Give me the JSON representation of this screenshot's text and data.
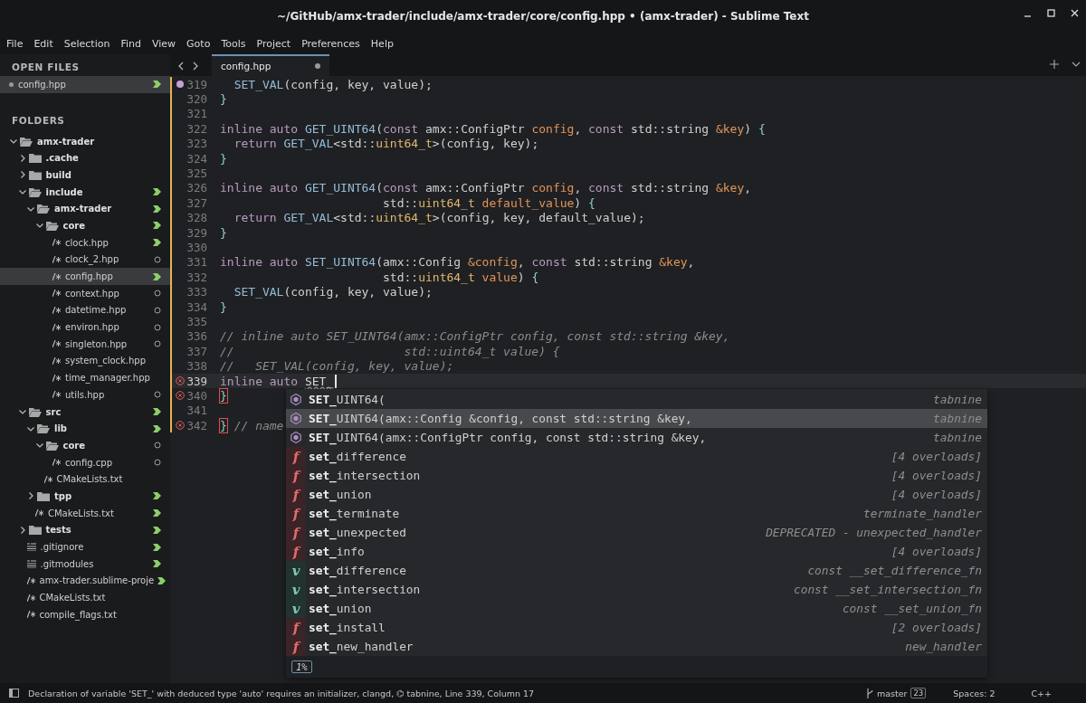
{
  "window": {
    "title": "~/GitHub/amx-trader/include/amx-trader/core/config.hpp • (amx-trader) - Sublime Text"
  },
  "menu": [
    "File",
    "Edit",
    "Selection",
    "Find",
    "View",
    "Goto",
    "Tools",
    "Project",
    "Preferences",
    "Help"
  ],
  "sidebar": {
    "open_files_header": "OPEN FILES",
    "open_files": [
      {
        "name": "config.hpp",
        "selected": true,
        "modified": true,
        "untracked": false
      }
    ],
    "folders_header": "FOLDERS",
    "tree": [
      {
        "name": "amx-trader",
        "kind": "folder",
        "expanded": true,
        "selected": false,
        "modified": false,
        "untracked": false,
        "children": [
          {
            "name": ".cache",
            "kind": "folder",
            "expanded": false,
            "selected": false,
            "modified": false,
            "untracked": false
          },
          {
            "name": "build",
            "kind": "folder",
            "expanded": false,
            "selected": false,
            "modified": false,
            "untracked": false
          },
          {
            "name": "include",
            "kind": "folder",
            "expanded": true,
            "selected": false,
            "modified": true,
            "untracked": false,
            "children": [
              {
                "name": "amx-trader",
                "kind": "folder",
                "expanded": true,
                "selected": false,
                "modified": true,
                "untracked": false,
                "children": [
                  {
                    "name": "core",
                    "kind": "folder",
                    "expanded": true,
                    "selected": false,
                    "modified": true,
                    "untracked": false,
                    "children": [
                      {
                        "name": "clock.hpp",
                        "kind": "code",
                        "selected": false,
                        "modified": true,
                        "untracked": false
                      },
                      {
                        "name": "clock_2.hpp",
                        "kind": "code",
                        "selected": false,
                        "modified": false,
                        "untracked": true
                      },
                      {
                        "name": "config.hpp",
                        "kind": "code",
                        "selected": true,
                        "modified": true,
                        "untracked": false
                      },
                      {
                        "name": "context.hpp",
                        "kind": "code",
                        "selected": false,
                        "modified": false,
                        "untracked": true
                      },
                      {
                        "name": "datetime.hpp",
                        "kind": "code",
                        "selected": false,
                        "modified": false,
                        "untracked": true
                      },
                      {
                        "name": "environ.hpp",
                        "kind": "code",
                        "selected": false,
                        "modified": false,
                        "untracked": true
                      },
                      {
                        "name": "singleton.hpp",
                        "kind": "code",
                        "selected": false,
                        "modified": false,
                        "untracked": true
                      },
                      {
                        "name": "system_clock.hpp",
                        "kind": "code",
                        "selected": false,
                        "modified": false,
                        "untracked": false
                      },
                      {
                        "name": "time_manager.hpp",
                        "kind": "code",
                        "selected": false,
                        "modified": false,
                        "untracked": false
                      },
                      {
                        "name": "utils.hpp",
                        "kind": "code",
                        "selected": false,
                        "modified": false,
                        "untracked": true
                      }
                    ]
                  }
                ]
              }
            ]
          },
          {
            "name": "src",
            "kind": "folder",
            "expanded": true,
            "selected": false,
            "modified": true,
            "untracked": false,
            "children": [
              {
                "name": "lib",
                "kind": "folder",
                "expanded": true,
                "selected": false,
                "modified": true,
                "untracked": false,
                "children": [
                  {
                    "name": "core",
                    "kind": "folder",
                    "expanded": true,
                    "selected": false,
                    "modified": false,
                    "untracked": true,
                    "children": [
                      {
                        "name": "config.cpp",
                        "kind": "code",
                        "selected": false,
                        "modified": false,
                        "untracked": true
                      }
                    ]
                  },
                  {
                    "name": "CMakeLists.txt",
                    "kind": "code",
                    "selected": false,
                    "modified": false,
                    "untracked": false
                  }
                ]
              },
              {
                "name": "tpp",
                "kind": "folder",
                "expanded": false,
                "selected": false,
                "modified": true,
                "untracked": false
              },
              {
                "name": "CMakeLists.txt",
                "kind": "code",
                "selected": false,
                "modified": true,
                "untracked": false
              }
            ]
          },
          {
            "name": "tests",
            "kind": "folder",
            "expanded": false,
            "selected": false,
            "modified": true,
            "untracked": false
          },
          {
            "name": ".gitignore",
            "kind": "text",
            "selected": false,
            "modified": true,
            "untracked": false
          },
          {
            "name": ".gitmodules",
            "kind": "text",
            "selected": false,
            "modified": true,
            "untracked": false
          },
          {
            "name": "amx-trader.sublime-proje",
            "kind": "code",
            "selected": false,
            "modified": true,
            "untracked": false
          },
          {
            "name": "CMakeLists.txt",
            "kind": "code",
            "selected": false,
            "modified": false,
            "untracked": false
          },
          {
            "name": "compile_flags.txt",
            "kind": "code",
            "selected": false,
            "modified": false,
            "untracked": false
          }
        ]
      }
    ]
  },
  "tabs": [
    {
      "label": "config.hpp",
      "selected": true,
      "dirty": true
    }
  ],
  "editor": {
    "lines": [
      {
        "number": "319",
        "bookmarked": true,
        "error": false,
        "current": false,
        "tokens": [
          {
            "text": "  SET_VAL",
            "kind": "function"
          },
          {
            "text": "(config, key, value);",
            "kind": "plain"
          }
        ]
      },
      {
        "number": "320",
        "bookmarked": false,
        "error": false,
        "current": false,
        "tokens": [
          {
            "text": "}",
            "kind": "brace"
          }
        ]
      },
      {
        "number": "321",
        "bookmarked": false,
        "error": false,
        "current": false
      },
      {
        "number": "322",
        "bookmarked": false,
        "error": false,
        "current": false,
        "tokens": [
          {
            "text": "inline auto ",
            "kind": "keyword"
          },
          {
            "text": "GET_UINT64",
            "kind": "function"
          },
          {
            "text": "(",
            "kind": "plain"
          },
          {
            "text": "const ",
            "kind": "keyword"
          },
          {
            "text": "amx::ConfigPtr ",
            "kind": "plain"
          },
          {
            "text": "config",
            "kind": "param"
          },
          {
            "text": ", ",
            "kind": "plain"
          },
          {
            "text": "const ",
            "kind": "keyword"
          },
          {
            "text": "std::string ",
            "kind": "plain"
          },
          {
            "text": "&key",
            "kind": "param"
          },
          {
            "text": ") ",
            "kind": "plain"
          },
          {
            "text": "{",
            "kind": "brace"
          }
        ]
      },
      {
        "number": "323",
        "bookmarked": false,
        "error": false,
        "current": false,
        "tokens": [
          {
            "text": "  return ",
            "kind": "keyword"
          },
          {
            "text": "GET_VAL",
            "kind": "function"
          },
          {
            "text": "<std::",
            "kind": "plain"
          },
          {
            "text": "uint64_t",
            "kind": "type"
          },
          {
            "text": ">(config, key);",
            "kind": "plain"
          }
        ]
      },
      {
        "number": "324",
        "bookmarked": false,
        "error": false,
        "current": false,
        "tokens": [
          {
            "text": "}",
            "kind": "brace"
          }
        ]
      },
      {
        "number": "325",
        "bookmarked": false,
        "error": false,
        "current": false
      },
      {
        "number": "326",
        "bookmarked": false,
        "error": false,
        "current": false,
        "tokens": [
          {
            "text": "inline auto ",
            "kind": "keyword"
          },
          {
            "text": "GET_UINT64",
            "kind": "function"
          },
          {
            "text": "(",
            "kind": "plain"
          },
          {
            "text": "const ",
            "kind": "keyword"
          },
          {
            "text": "amx::ConfigPtr ",
            "kind": "plain"
          },
          {
            "text": "config",
            "kind": "param"
          },
          {
            "text": ", ",
            "kind": "plain"
          },
          {
            "text": "const ",
            "kind": "keyword"
          },
          {
            "text": "std::string ",
            "kind": "plain"
          },
          {
            "text": "&key",
            "kind": "param"
          },
          {
            "text": ",",
            "kind": "plain"
          }
        ]
      },
      {
        "number": "327",
        "bookmarked": false,
        "error": false,
        "current": false,
        "tokens": [
          {
            "text": "                       std::",
            "kind": "plain"
          },
          {
            "text": "uint64_t ",
            "kind": "type"
          },
          {
            "text": "default_value",
            "kind": "param"
          },
          {
            "text": ") ",
            "kind": "plain"
          },
          {
            "text": "{",
            "kind": "brace"
          }
        ]
      },
      {
        "number": "328",
        "bookmarked": false,
        "error": false,
        "current": false,
        "tokens": [
          {
            "text": "  return ",
            "kind": "keyword"
          },
          {
            "text": "GET_VAL",
            "kind": "function"
          },
          {
            "text": "<std::",
            "kind": "plain"
          },
          {
            "text": "uint64_t",
            "kind": "type"
          },
          {
            "text": ">(config, key, default_value);",
            "kind": "plain"
          }
        ]
      },
      {
        "number": "329",
        "bookmarked": false,
        "error": false,
        "current": false,
        "tokens": [
          {
            "text": "}",
            "kind": "brace"
          }
        ]
      },
      {
        "number": "330",
        "bookmarked": false,
        "error": false,
        "current": false
      },
      {
        "number": "331",
        "bookmarked": false,
        "error": false,
        "current": false,
        "tokens": [
          {
            "text": "inline auto ",
            "kind": "keyword"
          },
          {
            "text": "SET_UINT64",
            "kind": "function"
          },
          {
            "text": "(amx::Config ",
            "kind": "plain"
          },
          {
            "text": "&config",
            "kind": "param"
          },
          {
            "text": ", ",
            "kind": "plain"
          },
          {
            "text": "const ",
            "kind": "keyword"
          },
          {
            "text": "std::string ",
            "kind": "plain"
          },
          {
            "text": "&key",
            "kind": "param"
          },
          {
            "text": ",",
            "kind": "plain"
          }
        ]
      },
      {
        "number": "332",
        "bookmarked": false,
        "error": false,
        "current": false,
        "tokens": [
          {
            "text": "                       std::",
            "kind": "plain"
          },
          {
            "text": "uint64_t ",
            "kind": "type"
          },
          {
            "text": "value",
            "kind": "param"
          },
          {
            "text": ") ",
            "kind": "plain"
          },
          {
            "text": "{",
            "kind": "brace"
          }
        ]
      },
      {
        "number": "333",
        "bookmarked": false,
        "error": false,
        "current": false,
        "tokens": [
          {
            "text": "  SET_VAL",
            "kind": "function"
          },
          {
            "text": "(config, key, value);",
            "kind": "plain"
          }
        ]
      },
      {
        "number": "334",
        "bookmarked": false,
        "error": false,
        "current": false,
        "tokens": [
          {
            "text": "}",
            "kind": "brace"
          }
        ]
      },
      {
        "number": "335",
        "bookmarked": false,
        "error": false,
        "current": false
      },
      {
        "number": "336",
        "bookmarked": false,
        "error": false,
        "current": false,
        "tokens": [
          {
            "text": "// inline auto SET_UINT64(amx::ConfigPtr config, const std::string &key,",
            "kind": "comment"
          }
        ]
      },
      {
        "number": "337",
        "bookmarked": false,
        "error": false,
        "current": false,
        "tokens": [
          {
            "text": "//                        std::uint64_t value) {",
            "kind": "comment"
          }
        ]
      },
      {
        "number": "338",
        "bookmarked": false,
        "error": false,
        "current": false,
        "tokens": [
          {
            "text": "//   SET_VAL(config, key, value);",
            "kind": "comment"
          }
        ]
      },
      {
        "number": "339",
        "bookmarked": false,
        "error": true,
        "current": true,
        "tokens": [
          {
            "text": "inline auto ",
            "kind": "keyword"
          },
          {
            "text": "SET_",
            "kind": "typed"
          }
        ]
      },
      {
        "number": "340",
        "bookmarked": false,
        "error": true,
        "current": false,
        "tokens": [
          {
            "text": "}",
            "kind": "error"
          }
        ]
      },
      {
        "number": "341",
        "bookmarked": false,
        "error": false,
        "current": false
      },
      {
        "number": "342",
        "bookmarked": false,
        "error": true,
        "current": false,
        "tokens": [
          {
            "text": "}",
            "kind": "error"
          },
          {
            "text": " // name",
            "kind": "comment"
          }
        ]
      }
    ]
  },
  "completions": {
    "items": [
      {
        "kind": "tabnine",
        "label": "**SET_**UINT64(",
        "detail": "tabnine",
        "selected": false
      },
      {
        "kind": "tabnine",
        "label": "**SET_**UINT64(amx::Config &config, const std::string &key,",
        "detail": "tabnine",
        "selected": true
      },
      {
        "kind": "tabnine",
        "label": "**SET_**UINT64(amx::ConfigPtr config, const std::string &key,",
        "detail": "tabnine",
        "selected": false
      },
      {
        "kind": "function",
        "badge": "f",
        "label": "**set_**difference",
        "detail": "[4 overloads]",
        "selected": false
      },
      {
        "kind": "function",
        "badge": "f",
        "label": "**set_**intersection",
        "detail": "[4 overloads]",
        "selected": false
      },
      {
        "kind": "function",
        "badge": "f",
        "label": "**set_**union",
        "detail": "[4 overloads]",
        "selected": false
      },
      {
        "kind": "function",
        "badge": "f",
        "label": "**set_**terminate",
        "detail": "terminate_handler",
        "selected": false
      },
      {
        "kind": "function",
        "badge": "f",
        "label": "**set_**unexpected",
        "detail": "DEPRECATED - unexpected_handler",
        "selected": false
      },
      {
        "kind": "function",
        "badge": "f",
        "label": "**set_**info",
        "detail": "[4 overloads]",
        "selected": false
      },
      {
        "kind": "variable",
        "badge": "v",
        "label": "**set_**difference",
        "detail": "const __set_difference_fn",
        "selected": false
      },
      {
        "kind": "variable",
        "badge": "v",
        "label": "**set_**intersection",
        "detail": "const __set_intersection_fn",
        "selected": false
      },
      {
        "kind": "variable",
        "badge": "v",
        "label": "**set_**union",
        "detail": "const __set_union_fn",
        "selected": false
      },
      {
        "kind": "function",
        "badge": "f",
        "label": "**set_**install",
        "detail": "[2 overloads]",
        "selected": false
      },
      {
        "kind": "function",
        "badge": "f",
        "label": "**set_**new_handler",
        "detail": "new_handler",
        "selected": false
      }
    ],
    "footer_badge": "1%"
  },
  "status_bar": {
    "message": "Declaration of variable 'SET_' with deduced type 'auto' requires an initializer, clangd, ⌬ tabnine, Line 339, Column 17",
    "branch": "master",
    "branch_count": "23",
    "indent": "Spaces: 2",
    "syntax": "C++"
  }
}
